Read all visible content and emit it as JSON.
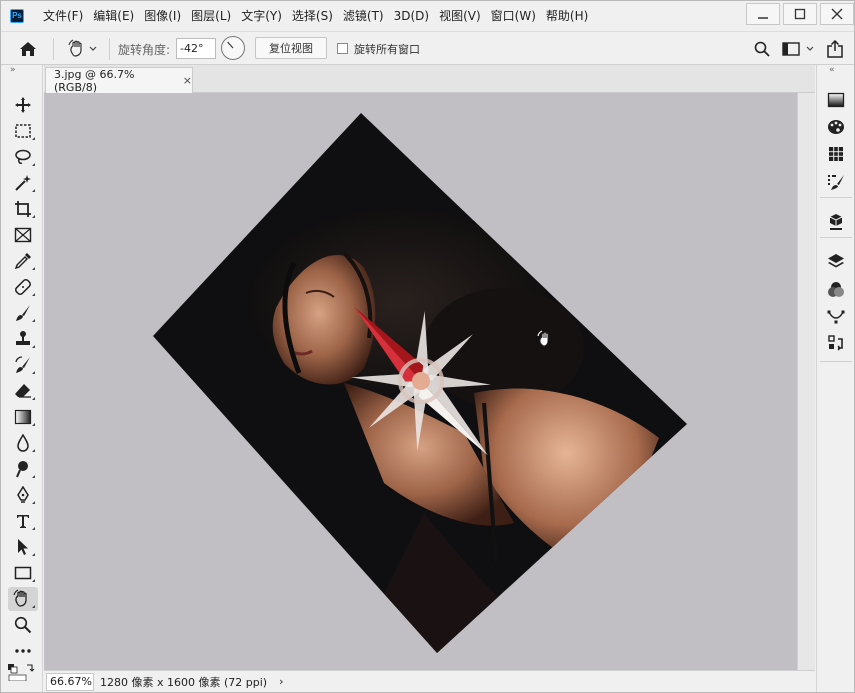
{
  "menu": {
    "items": [
      "文件(F)",
      "编辑(E)",
      "图像(I)",
      "图层(L)",
      "文字(Y)",
      "选择(S)",
      "滤镜(T)",
      "3D(D)",
      "视图(V)",
      "窗口(W)",
      "帮助(H)"
    ],
    "logo": "Ps"
  },
  "window_controls": {
    "minimize": "—",
    "maximize": "☐",
    "close": "✕"
  },
  "options_bar": {
    "rotate_angle_label": "旋转角度:",
    "rotate_angle_value": "-42°",
    "reset_view_label": "复位视图",
    "rotate_all_windows_label": "旋转所有窗口",
    "rotate_all_windows_checked": false
  },
  "document": {
    "tab_title": "3.jpg @ 66.7%(RGB/8)",
    "tab_close": "×",
    "rotation_deg": -42
  },
  "status": {
    "zoom": "66.67%",
    "info": "1280 像素 x 1600 像素 (72 ppi)",
    "arrow": "›"
  },
  "panels": {
    "left_collapse": "»",
    "right_collapse": "«"
  },
  "tools": [
    {
      "name": "move-tool",
      "icon": "move-icon"
    },
    {
      "name": "marquee-tool",
      "icon": "rect-marquee-icon"
    },
    {
      "name": "lasso-tool",
      "icon": "lasso-icon"
    },
    {
      "name": "magic-wand-tool",
      "icon": "magic-wand-icon"
    },
    {
      "name": "crop-tool",
      "icon": "crop-icon"
    },
    {
      "name": "frame-tool",
      "icon": "frame-icon"
    },
    {
      "name": "eyedropper-tool",
      "icon": "eyedropper-icon"
    },
    {
      "name": "healing-brush-tool",
      "icon": "bandage-icon"
    },
    {
      "name": "brush-tool",
      "icon": "brush-icon"
    },
    {
      "name": "clone-stamp-tool",
      "icon": "stamp-icon"
    },
    {
      "name": "history-brush-tool",
      "icon": "history-brush-icon"
    },
    {
      "name": "eraser-tool",
      "icon": "eraser-icon"
    },
    {
      "name": "gradient-tool",
      "icon": "gradient-icon"
    },
    {
      "name": "blur-tool",
      "icon": "drop-icon"
    },
    {
      "name": "dodge-tool",
      "icon": "dodge-icon"
    },
    {
      "name": "pen-tool",
      "icon": "pen-icon"
    },
    {
      "name": "type-tool",
      "icon": "type-icon"
    },
    {
      "name": "path-selection-tool",
      "icon": "arrow-icon"
    },
    {
      "name": "rectangle-tool",
      "icon": "rectangle-icon"
    },
    {
      "name": "rotate-view-tool",
      "icon": "rotate-hand-icon",
      "active": true
    },
    {
      "name": "zoom-tool",
      "icon": "zoom-icon"
    },
    {
      "name": "more-tools",
      "icon": "ellipsis-icon"
    }
  ],
  "right_icons": [
    "gradient-panel-icon",
    "color-palette-icon",
    "grid-icon",
    "brush-settings-icon",
    "library-icon",
    "layers-icon",
    "channels-icon",
    "paths-icon",
    "properties-icon"
  ]
}
